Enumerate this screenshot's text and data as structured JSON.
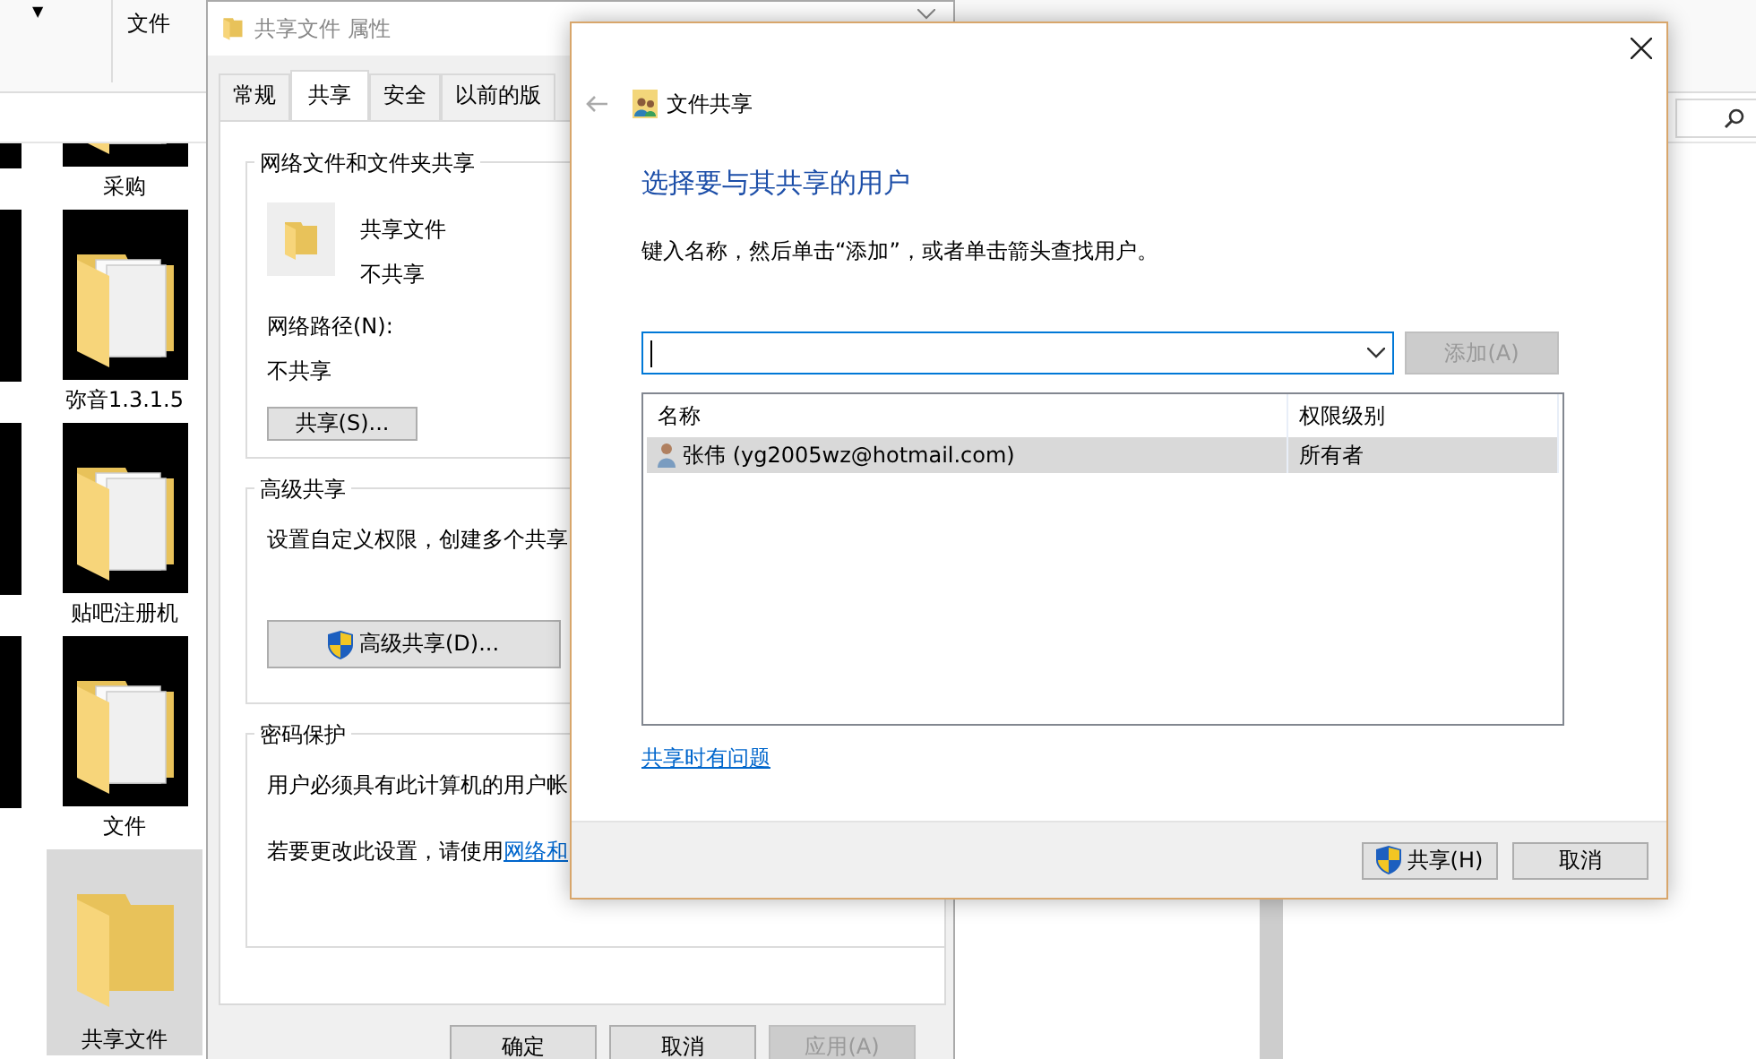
{
  "explorer": {
    "dropdown": "▼",
    "ribbon_label": "文件",
    "items": [
      {
        "name": "采购",
        "kind": "thumbnail",
        "selected": false
      },
      {
        "name": "弥音1.3.1.5",
        "kind": "thumbnail",
        "selected": false
      },
      {
        "name": "贴吧注册机",
        "kind": "thumbnail",
        "selected": false
      },
      {
        "name": "文件",
        "kind": "thumbnail",
        "selected": false
      },
      {
        "name": "共享文件",
        "kind": "folder",
        "selected": true
      }
    ]
  },
  "properties": {
    "title": "共享文件 属性",
    "tabs": [
      {
        "label": "常规",
        "selected": false
      },
      {
        "label": "共享",
        "selected": true
      },
      {
        "label": "安全",
        "selected": false
      },
      {
        "label": "以前的版",
        "selected": false
      }
    ],
    "network_sharing": {
      "heading": "网络文件和文件夹共享",
      "folder_name": "共享文件",
      "status": "不共享",
      "path_label": "网络路径(N):",
      "path_value": "不共享",
      "share_button": "共享(S)..."
    },
    "advanced": {
      "heading": "高级共享",
      "description": "设置自定义权限，创建多个共享",
      "button": "高级共享(D)..."
    },
    "password": {
      "heading": "密码保护",
      "text": "用户必须具有此计算机的用户帐",
      "change_text": "若要更改此设置，请使用",
      "change_link": "网络和"
    },
    "buttons": [
      {
        "label": "确定",
        "disabled": false
      },
      {
        "label": "取消",
        "disabled": false
      },
      {
        "label": "应用(A)",
        "disabled": true
      }
    ]
  },
  "share_dialog": {
    "title": "文件共享",
    "heading": "选择要与其共享的用户",
    "instruction": "键入名称，然后单击“添加”，或者单击箭头查找用户。",
    "add_button": {
      "label": "添加(A)",
      "disabled": true
    },
    "columns": [
      "名称",
      "权限级别"
    ],
    "rows": [
      {
        "name": "张伟 (yg2005wz@hotmail.com)",
        "permission": "所有者",
        "selected": true
      }
    ],
    "help_link": "共享时有问题",
    "buttons": [
      {
        "label": "共享(H)",
        "kind": "shield"
      },
      {
        "label": "取消",
        "kind": "plain"
      }
    ]
  }
}
